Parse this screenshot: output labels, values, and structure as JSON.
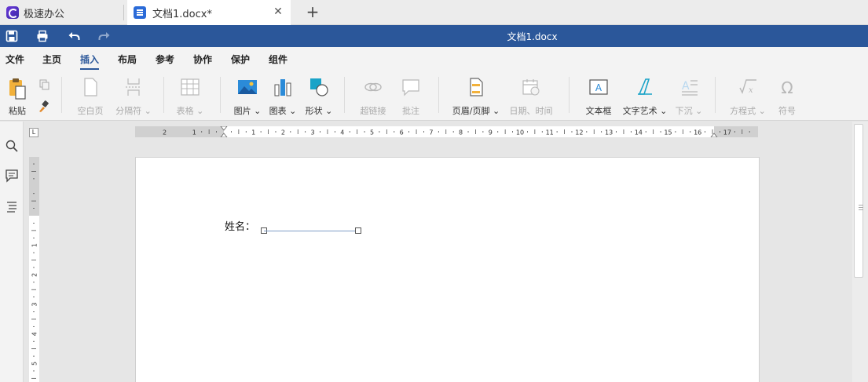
{
  "tabs": {
    "app_label": "极速办公",
    "doc_label": "文档1.docx*",
    "close": "✕",
    "new": "+"
  },
  "titlebar": {
    "title": "文档1.docx"
  },
  "menu": [
    "文件",
    "主页",
    "插入",
    "布局",
    "参考",
    "协作",
    "保护",
    "组件"
  ],
  "menu_active_index": 2,
  "ribbon": {
    "paste": "粘贴",
    "blank_page": "空白页",
    "page_break": "分隔符",
    "table": "表格",
    "picture": "图片",
    "chart": "图表",
    "shape": "形状",
    "hyperlink": "超链接",
    "comment": "批注",
    "header_footer": "页眉/页脚",
    "date_time": "日期、时间",
    "text_box": "文本框",
    "word_art": "文字艺术",
    "drop_cap": "下沉",
    "equation": "方程式",
    "symbol": "符号"
  },
  "ruler": {
    "h_labels": [
      "2",
      "1",
      "1",
      "2",
      "3",
      "4",
      "5",
      "6",
      "7",
      "8",
      "9",
      "10",
      "11",
      "12",
      "13",
      "14",
      "15",
      "16",
      "17"
    ],
    "v_labels": [
      "1",
      "2",
      "3",
      "4",
      "5"
    ]
  },
  "corner": "L",
  "document": {
    "field_label": "姓名："
  },
  "colors": {
    "title_blue": "#2b579a",
    "accent": "#2b6bd8"
  }
}
